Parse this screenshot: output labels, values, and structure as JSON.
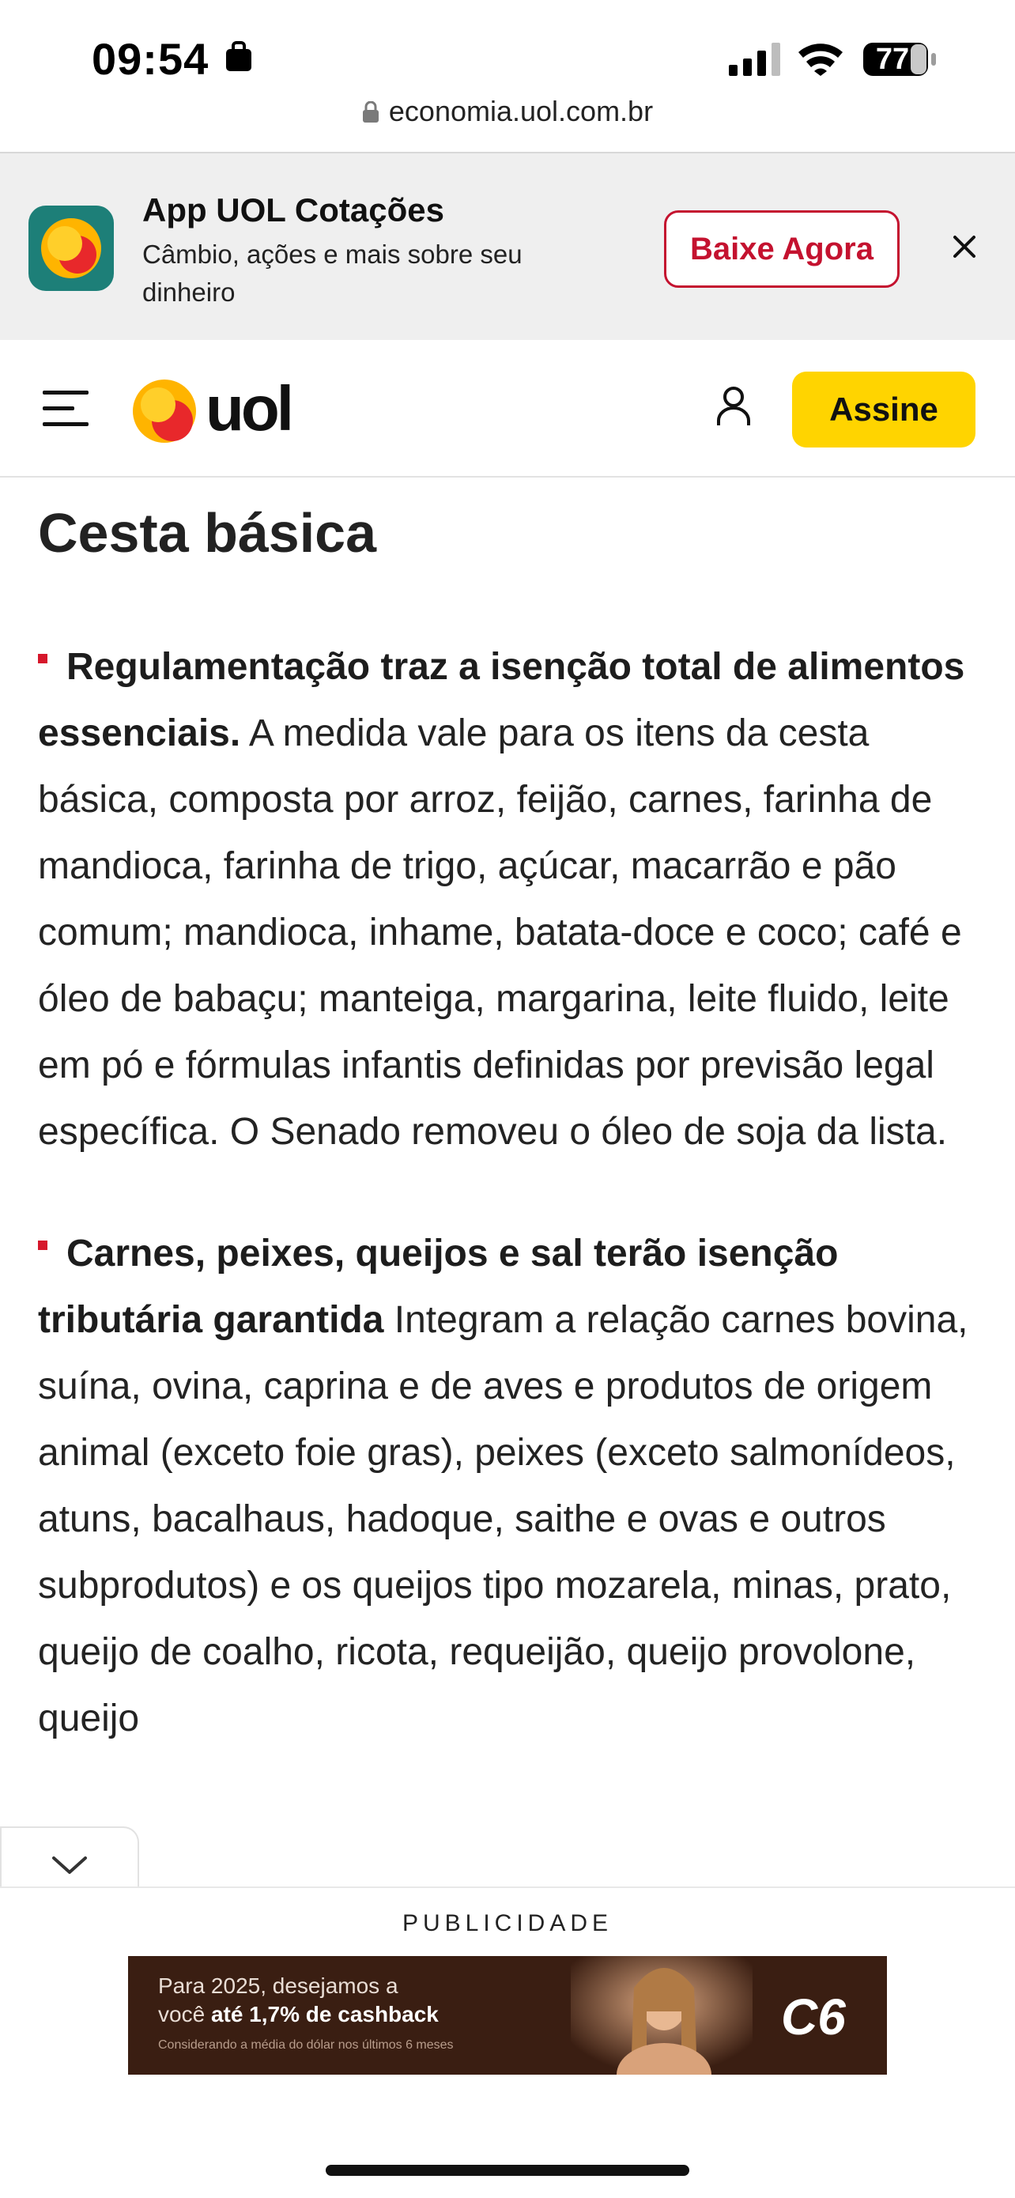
{
  "status_bar": {
    "time": "09:54",
    "battery": "77"
  },
  "browser": {
    "url": "economia.uol.com.br"
  },
  "app_banner": {
    "title": "App UOL Cotações",
    "subtitle": "Câmbio, ações e mais sobre seu dinheiro",
    "cta_label": "Baixe Agora"
  },
  "header": {
    "logo_text": "uol",
    "subscribe_label": "Assine"
  },
  "article": {
    "section_title": "Cesta básica",
    "paragraphs": [
      {
        "bold": "Regulamentação traz a isenção total de alimentos essenciais.",
        "text": " A medida vale para os itens da cesta básica, composta por arroz, feijão, carnes, farinha de mandioca, farinha de trigo, açúcar, macarrão e pão comum; mandioca, inhame, batata-doce e coco; café e óleo de babaçu; manteiga, margarina, leite fluido, leite em pó e fórmulas infantis definidas por previsão legal específica. O Senado removeu o óleo de soja da lista."
      },
      {
        "bold": "Carnes, peixes, queijos e sal terão isenção tributária garantida",
        "text": " Integram a relação carnes bovina, suína, ovina, caprina e de aves e produtos de origem animal (exceto foie gras), peixes (exceto salmonídeos, atuns, bacalhaus, hadoque, saithe e ovas e outros subprodutos) e os queijos tipo mozarela, minas, prato, queijo de coalho, ricota, requeijão, queijo provolone, queijo"
      }
    ]
  },
  "ad": {
    "label": "PUBLICIDADE",
    "line1": "Para 2025, desejamos a",
    "line2_prefix": "você ",
    "line2_bold": "até 1,7% de cashback",
    "line3": "Considerando a média do dólar nos últimos 6 meses",
    "brand": "C6"
  },
  "colors": {
    "accent_red": "#c4122f",
    "assine_yellow": "#ffd400",
    "app_icon_teal": "#1d7f78"
  }
}
